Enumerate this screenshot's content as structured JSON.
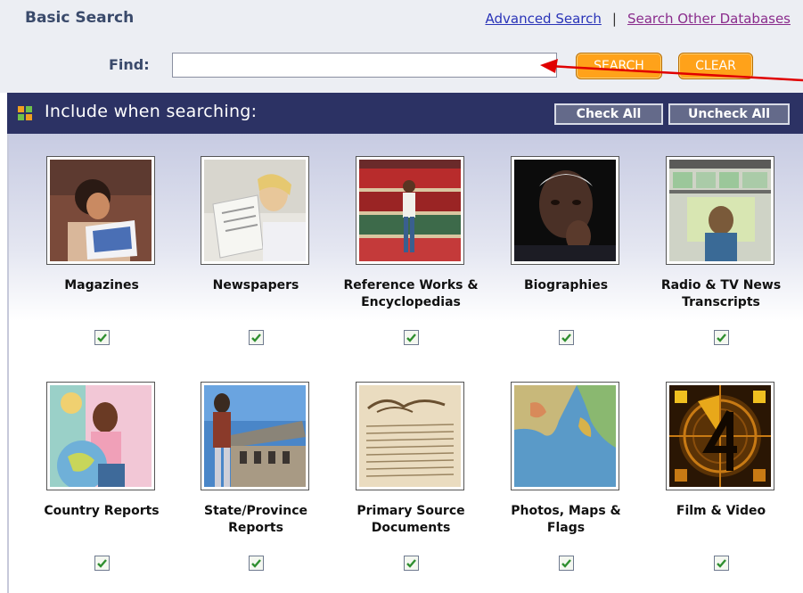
{
  "header": {
    "title": "Basic Search",
    "advanced_link": "Advanced Search",
    "separator": "|",
    "other_link": "Search Other Databases"
  },
  "find": {
    "label": "Find:",
    "value": "",
    "placeholder": "",
    "search_button": "SEARCH",
    "clear_button": "CLEAR"
  },
  "panel": {
    "title": "Include when searching:",
    "check_all": "Check All",
    "uncheck_all": "Uncheck All"
  },
  "categories": [
    {
      "label": "Magazines",
      "checked": true
    },
    {
      "label": "Newspapers",
      "checked": true
    },
    {
      "label": "Reference Works & Encyclopedias",
      "checked": true
    },
    {
      "label": "Biographies",
      "checked": true
    },
    {
      "label": "Radio & TV News Transcripts",
      "checked": true
    },
    {
      "label": "Country Reports",
      "checked": true
    },
    {
      "label": "State/Province Reports",
      "checked": true
    },
    {
      "label": "Primary Source Documents",
      "checked": true
    },
    {
      "label": "Photos, Maps & Flags",
      "checked": true
    },
    {
      "label": "Film & Video",
      "checked": true
    }
  ],
  "colors": {
    "header_bar": "#2c3264",
    "button_orange": "#ffa21a",
    "checkbox_green": "#2f8f2f",
    "annotation_arrow": "#e00000"
  }
}
